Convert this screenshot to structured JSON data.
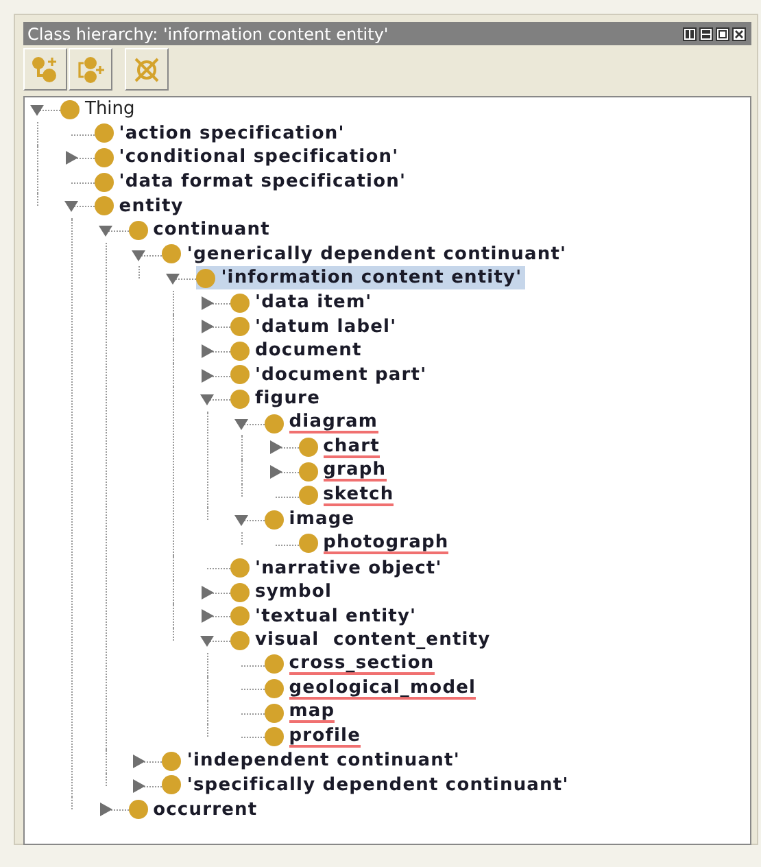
{
  "window": {
    "title": "Class hierarchy: 'information content entity'"
  },
  "tree": [
    {
      "label": "Thing",
      "kind": "node",
      "expanded": true,
      "selected": false,
      "flagged": false,
      "children": [
        {
          "label": "'action specification'",
          "kind": "leaf",
          "selected": false,
          "flagged": false
        },
        {
          "label": "'conditional specification'",
          "kind": "node",
          "expanded": false,
          "selected": false,
          "flagged": false
        },
        {
          "label": "'data format specification'",
          "kind": "leaf",
          "selected": false,
          "flagged": false
        },
        {
          "label": "entity",
          "kind": "node",
          "expanded": true,
          "selected": false,
          "flagged": false,
          "children": [
            {
              "label": "continuant",
              "kind": "node",
              "expanded": true,
              "selected": false,
              "flagged": false,
              "children": [
                {
                  "label": "'generically dependent continuant'",
                  "kind": "node",
                  "expanded": true,
                  "selected": false,
                  "flagged": false,
                  "children": [
                    {
                      "label": "'information content entity'",
                      "kind": "node",
                      "expanded": true,
                      "selected": true,
                      "flagged": false,
                      "children": [
                        {
                          "label": "'data item'",
                          "kind": "node",
                          "expanded": false,
                          "selected": false,
                          "flagged": false
                        },
                        {
                          "label": "'datum label'",
                          "kind": "node",
                          "expanded": false,
                          "selected": false,
                          "flagged": false
                        },
                        {
                          "label": "document",
                          "kind": "node",
                          "expanded": false,
                          "selected": false,
                          "flagged": false
                        },
                        {
                          "label": "'document part'",
                          "kind": "node",
                          "expanded": false,
                          "selected": false,
                          "flagged": false
                        },
                        {
                          "label": "figure",
                          "kind": "node",
                          "expanded": true,
                          "selected": false,
                          "flagged": false,
                          "children": [
                            {
                              "label": "diagram",
                              "kind": "node",
                              "expanded": true,
                              "selected": false,
                              "flagged": true,
                              "children": [
                                {
                                  "label": "chart",
                                  "kind": "node",
                                  "expanded": false,
                                  "selected": false,
                                  "flagged": true
                                },
                                {
                                  "label": "graph",
                                  "kind": "node",
                                  "expanded": false,
                                  "selected": false,
                                  "flagged": true
                                },
                                {
                                  "label": "sketch",
                                  "kind": "leaf",
                                  "selected": false,
                                  "flagged": true
                                }
                              ]
                            },
                            {
                              "label": "image",
                              "kind": "node",
                              "expanded": true,
                              "selected": false,
                              "flagged": false,
                              "children": [
                                {
                                  "label": "photograph",
                                  "kind": "leaf",
                                  "selected": false,
                                  "flagged": true
                                }
                              ]
                            }
                          ]
                        },
                        {
                          "label": "'narrative object'",
                          "kind": "leaf",
                          "selected": false,
                          "flagged": false
                        },
                        {
                          "label": "symbol",
                          "kind": "node",
                          "expanded": false,
                          "selected": false,
                          "flagged": false
                        },
                        {
                          "label": "'textual entity'",
                          "kind": "node",
                          "expanded": false,
                          "selected": false,
                          "flagged": false
                        },
                        {
                          "label": "visual  content_entity",
                          "kind": "node",
                          "expanded": true,
                          "selected": false,
                          "flagged": false,
                          "children": [
                            {
                              "label": "cross_section",
                              "kind": "leaf",
                              "selected": false,
                              "flagged": true
                            },
                            {
                              "label": "geological_model",
                              "kind": "leaf",
                              "selected": false,
                              "flagged": true
                            },
                            {
                              "label": "map",
                              "kind": "leaf",
                              "selected": false,
                              "flagged": true
                            },
                            {
                              "label": "profile",
                              "kind": "leaf",
                              "selected": false,
                              "flagged": true
                            }
                          ]
                        }
                      ]
                    }
                  ]
                },
                {
                  "label": "'independent continuant'",
                  "kind": "node",
                  "expanded": false,
                  "selected": false,
                  "flagged": false
                },
                {
                  "label": "'specifically dependent continuant'",
                  "kind": "node",
                  "expanded": false,
                  "selected": false,
                  "flagged": false
                }
              ]
            },
            {
              "label": "occurrent",
              "kind": "node",
              "expanded": false,
              "selected": false,
              "flagged": false
            }
          ]
        }
      ]
    }
  ]
}
